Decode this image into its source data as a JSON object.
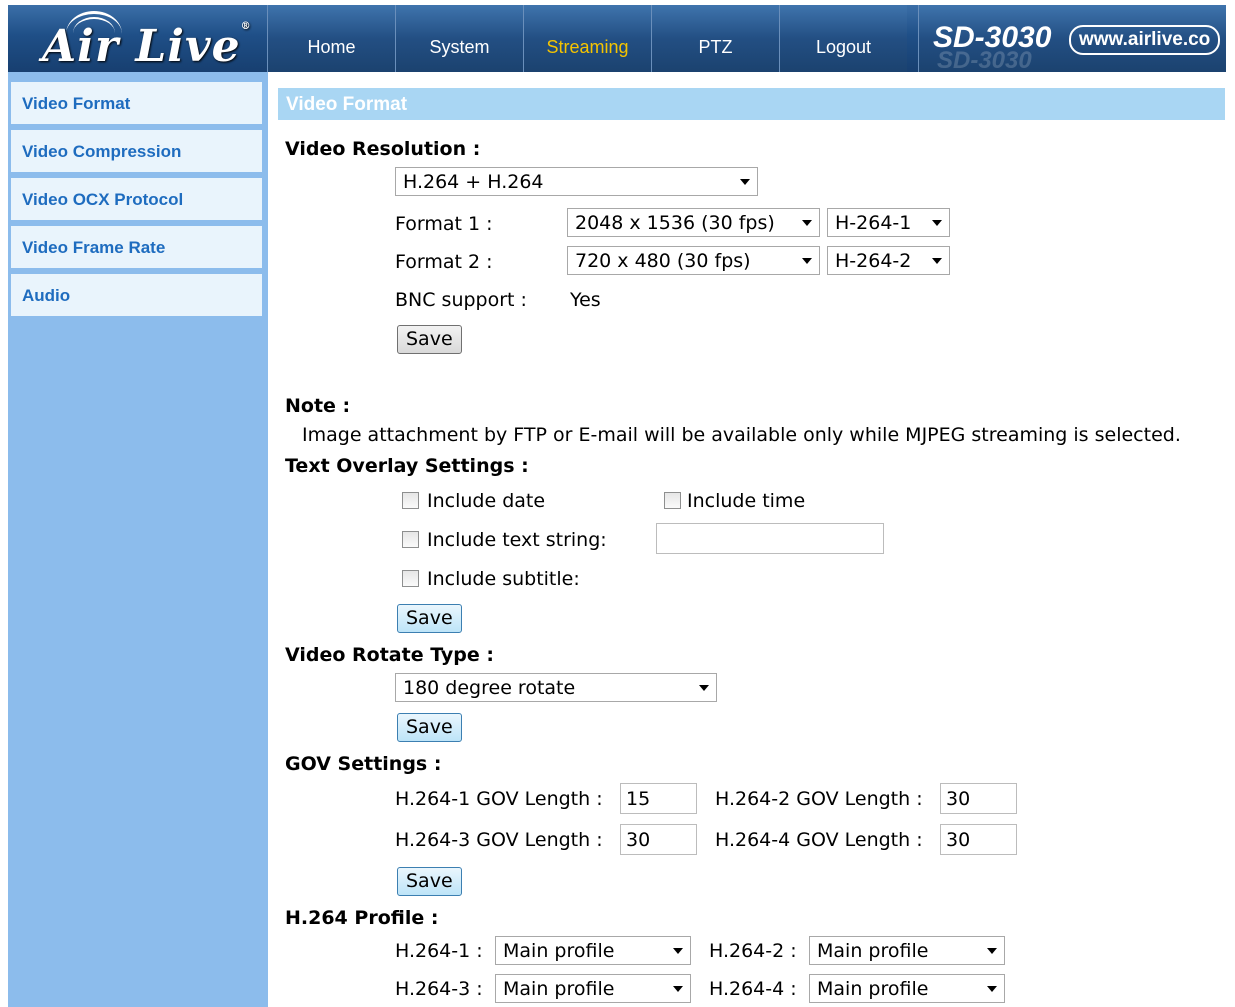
{
  "brand": {
    "logo_text": "Air Live",
    "model": "SD-3030",
    "model_ghost": "SD-3030",
    "url": "www.airlive.co"
  },
  "nav": {
    "items": [
      "Home",
      "System",
      "Streaming",
      "PTZ",
      "Logout"
    ],
    "active": "Streaming",
    "active_color": "#f5c400"
  },
  "sidebar": {
    "items": [
      "Video Format",
      "Video Compression",
      "Video OCX Protocol",
      "Video Frame Rate",
      "Audio"
    ]
  },
  "page": {
    "title": "Video Format",
    "resolution": {
      "heading": "Video Resolution :",
      "mode": "H.264 + H.264",
      "format1": {
        "label": "Format 1 :",
        "resolution": "2048 x 1536 (30 fps)",
        "codec": "H-264-1"
      },
      "format2": {
        "label": "Format 2 :",
        "resolution": "720 x 480 (30 fps)",
        "codec": "H-264-2"
      },
      "bnc_label": "BNC support :",
      "bnc_value": "Yes",
      "save": "Save"
    },
    "note": {
      "heading": "Note :",
      "text": "Image attachment by FTP or E-mail will be available only while MJPEG streaming is selected."
    },
    "overlay": {
      "heading": "Text Overlay Settings :",
      "include_date": "Include date",
      "include_time": "Include time",
      "include_text": "Include text string:",
      "text_value": "",
      "include_subtitle": "Include subtitle:",
      "save": "Save"
    },
    "rotate": {
      "heading": "Video Rotate Type :",
      "value": "180 degree rotate",
      "save": "Save"
    },
    "gov": {
      "heading": "GOV Settings :",
      "h1_label": "H.264-1 GOV Length :",
      "h1_value": "15",
      "h2_label": "H.264-2 GOV Length :",
      "h2_value": "30",
      "h3_label": "H.264-3 GOV Length :",
      "h3_value": "30",
      "h4_label": "H.264-4 GOV Length :",
      "h4_value": "30",
      "save": "Save"
    },
    "profile": {
      "heading": "H.264 Profile :",
      "p1_label": "H.264-1 :",
      "p1_value": "Main profile",
      "p2_label": "H.264-2 :",
      "p2_value": "Main profile",
      "p3_label": "H.264-3 :",
      "p3_value": "Main profile",
      "p4_label": "H.264-4 :",
      "p4_value": "Main profile"
    }
  }
}
